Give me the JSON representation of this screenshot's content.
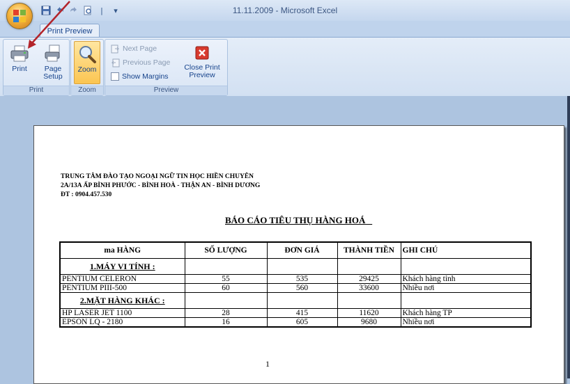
{
  "window": {
    "title": "11.11.2009 - Microsoft Excel"
  },
  "qat": {
    "save_icon": "save-icon",
    "undo_icon": "undo-icon",
    "redo_icon": "redo-icon",
    "preview_icon": "print-preview-icon",
    "customize_icon": "customize-qat-icon",
    "separator": "|",
    "dropdown": "▾"
  },
  "tabs": [
    {
      "label": "Print Preview"
    }
  ],
  "ribbon": {
    "groups": {
      "print": {
        "label": "Print"
      },
      "zoom": {
        "label": "Zoom"
      },
      "preview": {
        "label": "Preview"
      }
    },
    "print_button": "Print",
    "page_setup_button_line1": "Page",
    "page_setup_button_line2": "Setup",
    "zoom_button": "Zoom",
    "next_page": "Next Page",
    "previous_page": "Previous Page",
    "show_margins": "Show Margins",
    "close_preview_line1": "Close Print",
    "close_preview_line2": "Preview"
  },
  "colors": {
    "ribbon_text": "#15428b",
    "disabled_text": "#8a9bb3",
    "zoom_highlight": "#fbc552",
    "close_red": "#d83a2e",
    "arrow": "#b3242a",
    "workspace": "#adc4e0"
  },
  "document": {
    "header": {
      "line1": "TRUNG TÂM ĐÀO TẠO NGOẠI NGỮ TIN HỌC HIỀN CHUYÊN",
      "line2": "2A/13A  ẤP BÌNH PHƯỚC - BÌNH HOÀ - THẬN AN - BÌNH DƯƠNG",
      "line3": "ĐT : 0904.457.530"
    },
    "report_title": "BÁO CÁO TIÊU THỤ HÀNG HOÁ   ",
    "table": {
      "headers": [
        "ma HÀNG",
        "SỐ LƯỢNG",
        "ĐƠN GIÁ",
        "THÀNH TIỀN",
        "GHI CHÚ"
      ],
      "group1": "1.MÁY VI TÍNH :",
      "group1_rows": [
        [
          "PENTIUM CELERON",
          "55",
          "535",
          "29425",
          "Khách hàng tỉnh"
        ],
        [
          "PENTIUM PIII-500",
          "60",
          "560",
          "33600",
          "Nhiều nơi"
        ]
      ],
      "group2": "2.MẶT HÀNG KHÁC :",
      "group2_rows": [
        [
          "HP LASER JET 1100",
          "28",
          "415",
          "11620",
          "Khách hàng TP"
        ],
        [
          "EPSON LQ - 2180",
          "16",
          "605",
          "9680",
          "Nhiều nơi"
        ]
      ]
    },
    "page_number": "1"
  }
}
